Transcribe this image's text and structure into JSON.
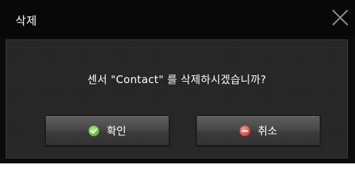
{
  "dialog": {
    "title": "삭제",
    "message": "센서 \"Contact\" 를 삭제하시겠습니까?",
    "close_icon": "close-x-icon"
  },
  "buttons": {
    "ok_label": "확인",
    "ok_icon": "check-circle-icon",
    "cancel_label": "취소",
    "cancel_icon": "minus-circle-icon"
  },
  "colors": {
    "background": "#0b0b0b",
    "panel": "#262626",
    "ok_icon": "#7ed957",
    "cancel_icon": "#f0605a"
  }
}
